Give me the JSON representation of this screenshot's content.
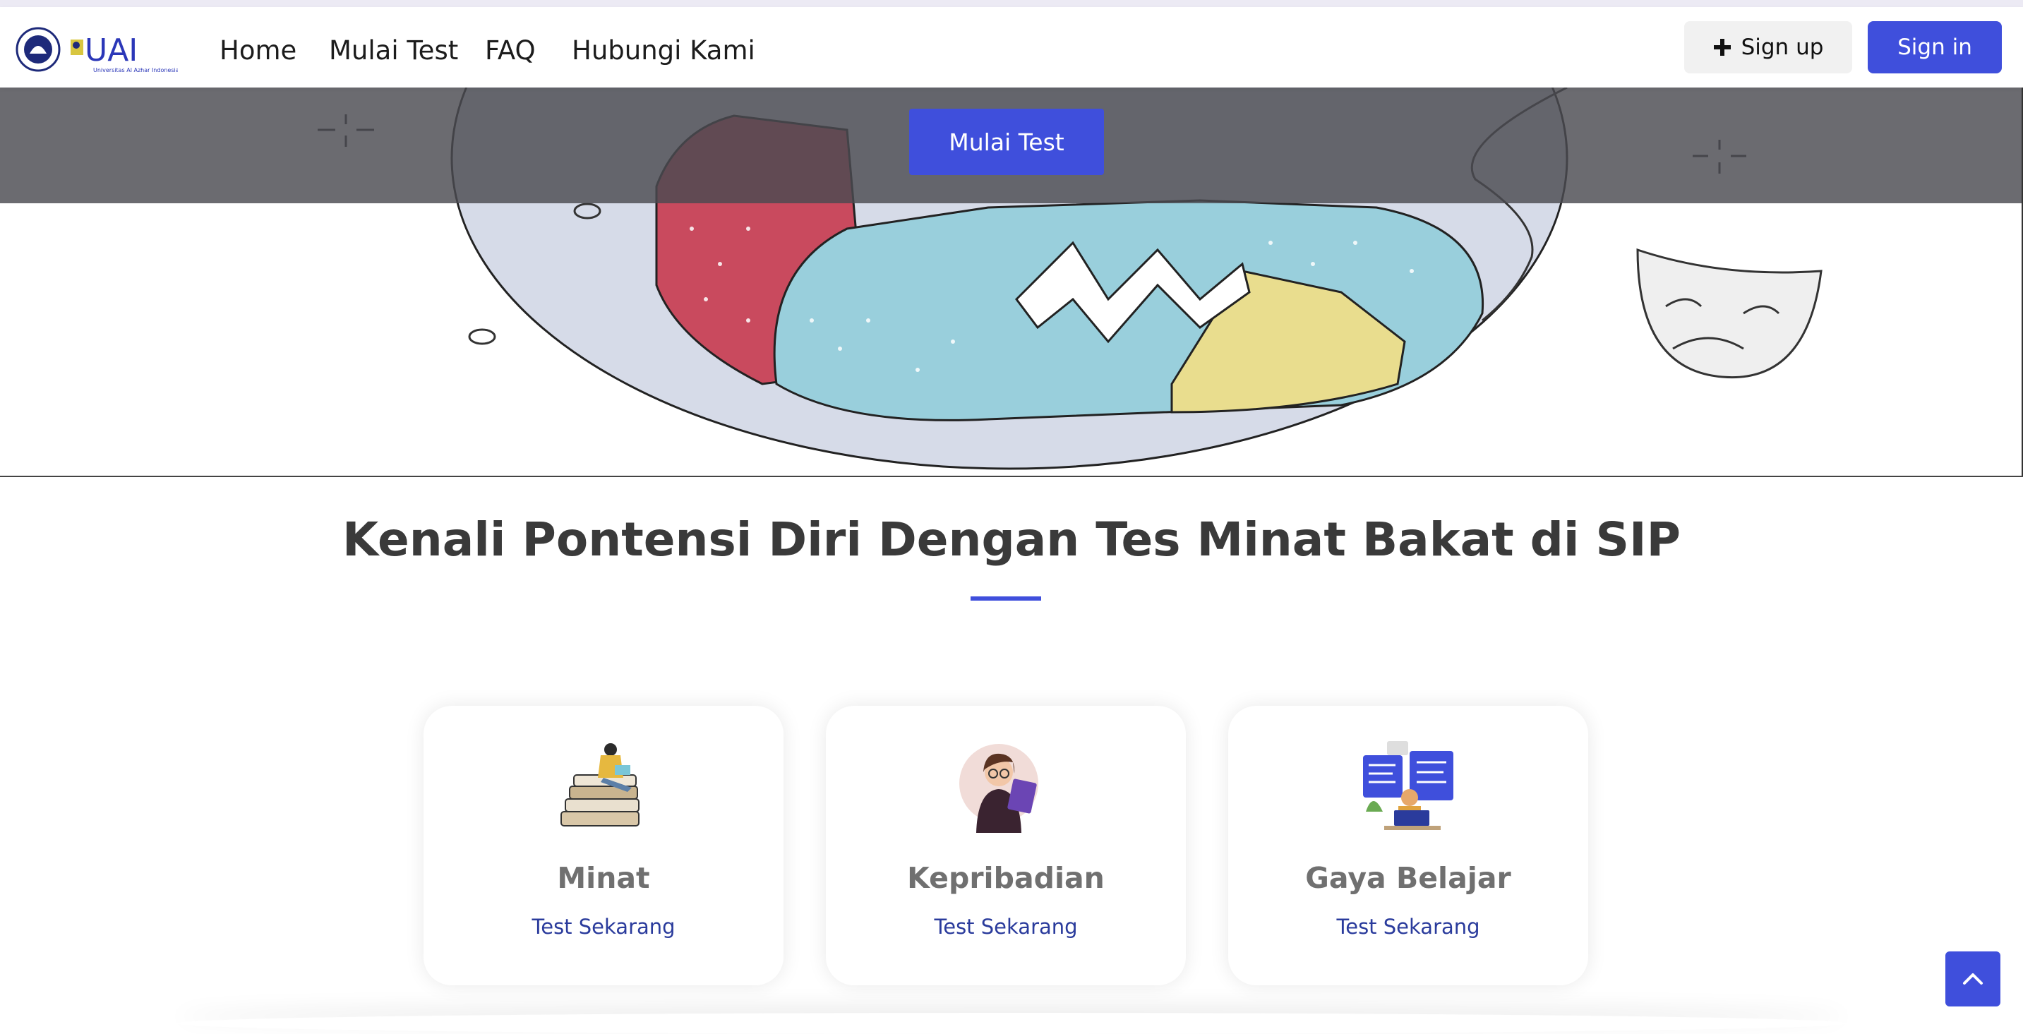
{
  "nav": {
    "links": [
      "Home",
      "Mulai Test",
      "FAQ",
      "Hubungi Kami"
    ],
    "signup_label": "Sign up",
    "signin_label": "Sign in",
    "logo_text": "UAI",
    "logo_subtext": "Universitas Al Azhar Indonesia"
  },
  "hero": {
    "button_label": "Mulai Test"
  },
  "main": {
    "headline": "Kenali Pontensi Diri Dengan Tes Minat Bakat di SIP"
  },
  "cards": [
    {
      "title": "Minat",
      "link": "Test Sekarang",
      "icon": "reading-on-books-icon"
    },
    {
      "title": "Kepribadian",
      "link": "Test Sekarang",
      "icon": "woman-reading-icon"
    },
    {
      "title": "Gaya Belajar",
      "link": "Test Sekarang",
      "icon": "learning-screens-icon"
    }
  ],
  "colors": {
    "accent": "#3f4fdc",
    "link": "#2a3b9c",
    "heading": "#3a3a3a"
  }
}
